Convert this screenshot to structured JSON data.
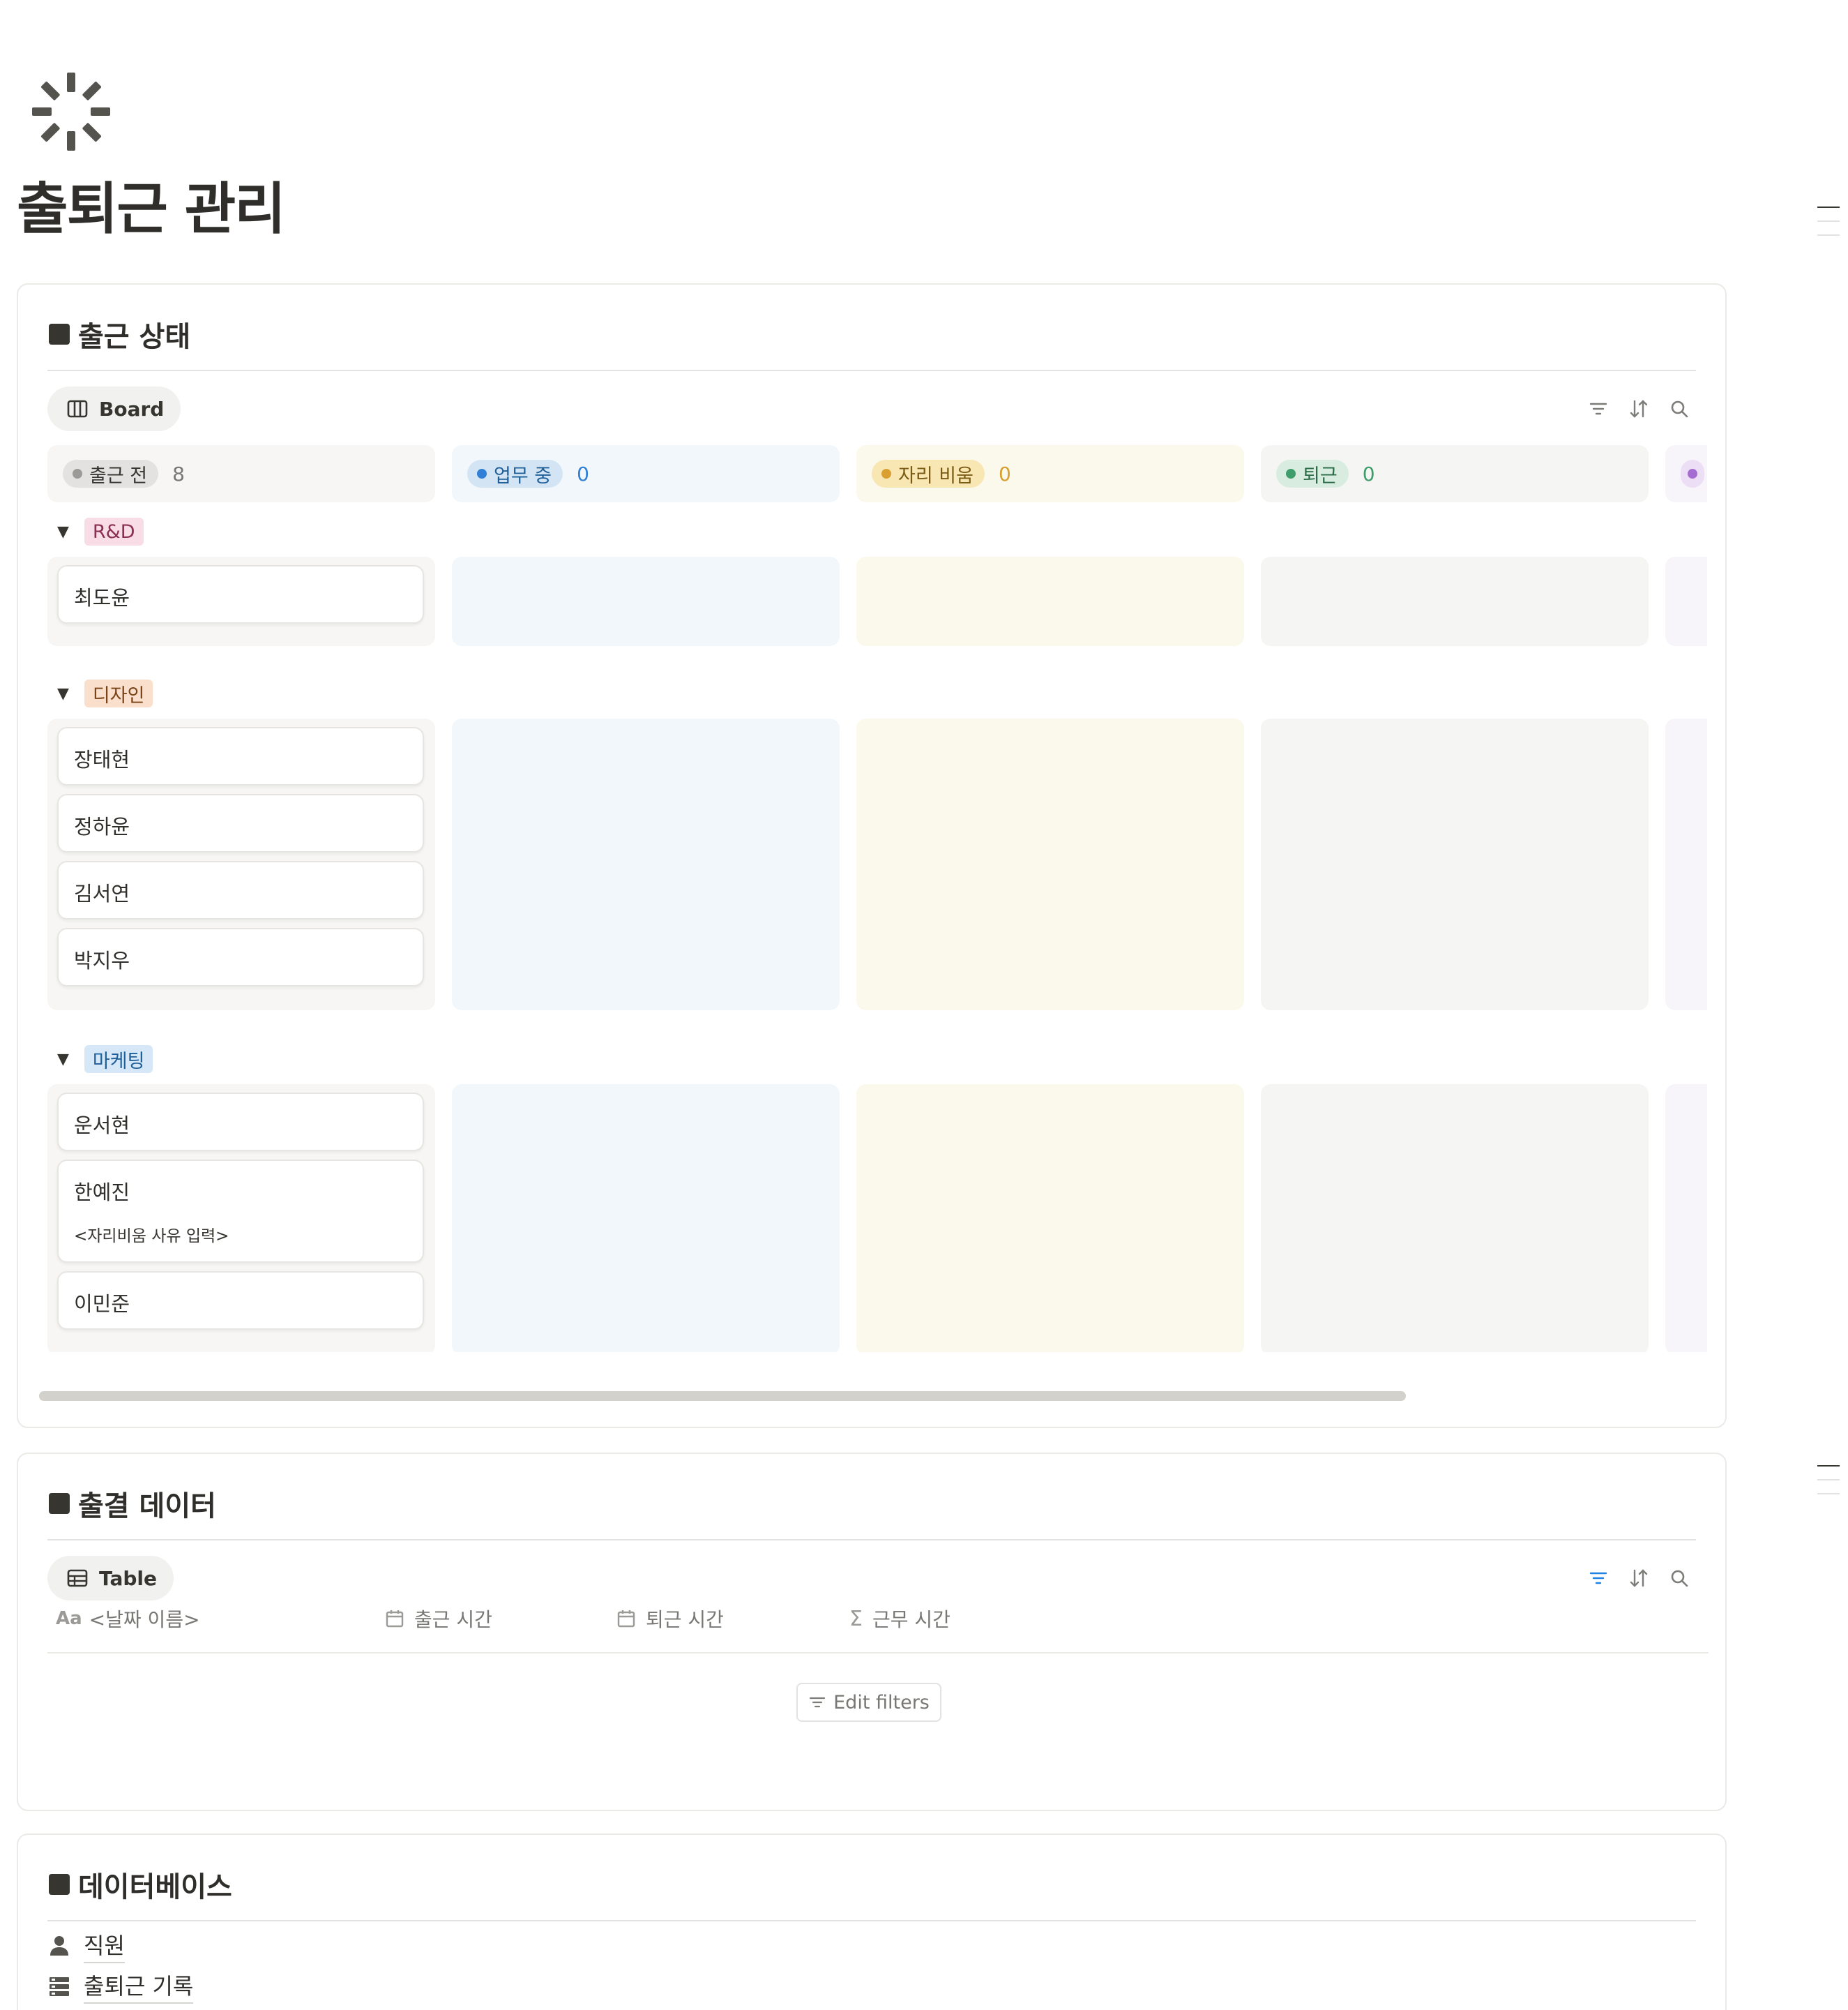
{
  "page": {
    "title": "출퇴근 관리",
    "icon": "loading-spinner-icon"
  },
  "status_section": {
    "title": "출근 상태",
    "view_label": "Board",
    "view_icon": "board-view-icon",
    "tools": [
      "filter-icon",
      "sort-icon",
      "search-icon"
    ],
    "columns": [
      {
        "label": "출근 전",
        "count": "8",
        "color": "#9b9a97",
        "bg": "#f7f6f4",
        "tag_bg": "#e3e2e0",
        "text": "#37352f",
        "cell_bg": "#f7f6f4"
      },
      {
        "label": "업무 중",
        "count": "0",
        "color": "#2f80d6",
        "bg": "#f2f7fb",
        "tag_bg": "#d3e5f5",
        "text": "#1f5f99",
        "cell_bg": "#f2f7fb"
      },
      {
        "label": "자리 비움",
        "count": "0",
        "color": "#d9a031",
        "bg": "#fbf8ec",
        "tag_bg": "#f8e7b3",
        "text": "#7a5a14",
        "cell_bg": "#fbf8ec"
      },
      {
        "label": "퇴근",
        "count": "0",
        "color": "#3f9d6c",
        "bg": "#f5f6f4",
        "tag_bg": "#d8ecdf",
        "text": "#2b6b48",
        "cell_bg": "#f5f6f4"
      },
      {
        "label": "",
        "count": "",
        "color": "#a56cd1",
        "bg": "#f7f5fa",
        "tag_bg": "#ecdff5",
        "text": "#6b3f8e",
        "cell_bg": "#f7f5fa"
      }
    ],
    "groups": [
      {
        "label": "R&D",
        "tag_bg": "#f8dce6",
        "tag_text": "#8a2f52",
        "cards": [
          {
            "name": "최도윤"
          }
        ]
      },
      {
        "label": "디자인",
        "tag_bg": "#fae0cc",
        "tag_text": "#7a4418",
        "cards": [
          {
            "name": "장태현"
          },
          {
            "name": "정하윤"
          },
          {
            "name": "김서연"
          },
          {
            "name": "박지우"
          }
        ]
      },
      {
        "label": "마케팅",
        "tag_bg": "#d6e8f7",
        "tag_text": "#1f5f99",
        "cards": [
          {
            "name": "운서현"
          },
          {
            "name": "한예진",
            "sub": "<자리비움 사유 입력>"
          },
          {
            "name": "이민준"
          }
        ]
      }
    ]
  },
  "attendance_section": {
    "title": "출결 데이터",
    "view_label": "Table",
    "view_icon": "table-view-icon",
    "tools": [
      "filter-icon",
      "sort-icon",
      "search-icon"
    ],
    "filter_active_color": "#2383e2",
    "columns": [
      {
        "label": "<날짜 이름>",
        "icon": "title-property-icon"
      },
      {
        "label": "출근 시간",
        "icon": "calendar-icon"
      },
      {
        "label": "퇴근 시간",
        "icon": "calendar-icon"
      },
      {
        "label": "근무 시간",
        "icon": "sigma-icon"
      }
    ],
    "empty_action": "Edit filters"
  },
  "database_section": {
    "title": "데이터베이스",
    "items": [
      {
        "label": "직원",
        "icon": "person-icon"
      },
      {
        "label": "출퇴근 기록",
        "icon": "database-icon"
      }
    ]
  }
}
